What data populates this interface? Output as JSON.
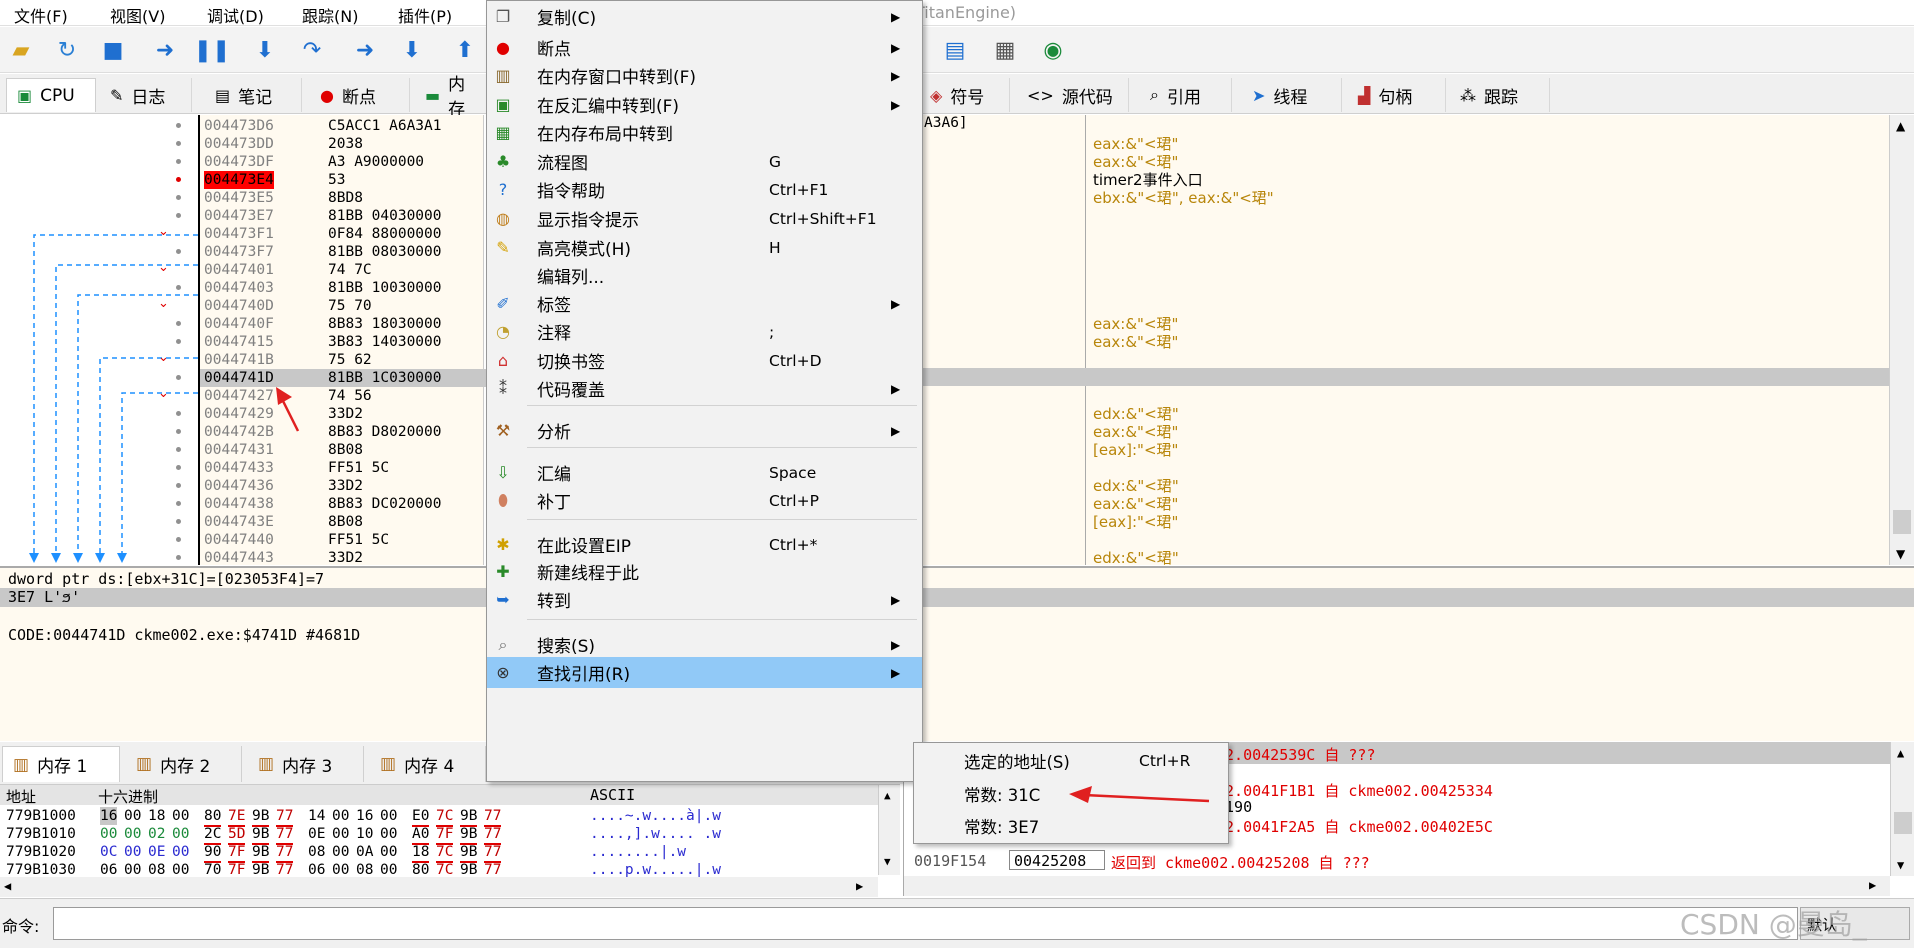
{
  "menubar": {
    "items": [
      "文件(F)",
      "视图(V)",
      "调试(D)",
      "跟踪(N)",
      "插件(P)"
    ],
    "title_fragment": "TitanEngine)"
  },
  "tabs": [
    "CPU",
    "日志",
    "笔记",
    "断点",
    "内存"
  ],
  "tabs_right": [
    "符号",
    "源代码",
    "引用",
    "线程",
    "句柄",
    "跟踪"
  ],
  "disasm": {
    "rows": [
      {
        "addr": "004473D6",
        "bytes": "C5ACC1 A6A3A1",
        "mark": ""
      },
      {
        "addr": "004473DD",
        "bytes": "2038",
        "mark": ""
      },
      {
        "addr": "004473DF",
        "bytes": "A3 A9000000",
        "mark": ""
      },
      {
        "addr": "004473E4",
        "bytes": "53",
        "mark": "bp"
      },
      {
        "addr": "004473E5",
        "bytes": "8BD8",
        "mark": ""
      },
      {
        "addr": "004473E7",
        "bytes": "81BB 04030000",
        "mark": ""
      },
      {
        "addr": "004473F1",
        "bytes": "0F84 88000000",
        "mark": "jmp"
      },
      {
        "addr": "004473F7",
        "bytes": "81BB 08030000",
        "mark": ""
      },
      {
        "addr": "00447401",
        "bytes": "74 7C",
        "mark": "jmp"
      },
      {
        "addr": "00447403",
        "bytes": "81BB 10030000",
        "mark": ""
      },
      {
        "addr": "0044740D",
        "bytes": "75 70",
        "mark": "jmp"
      },
      {
        "addr": "0044740F",
        "bytes": "8B83 18030000",
        "mark": ""
      },
      {
        "addr": "00447415",
        "bytes": "3B83 14030000",
        "mark": ""
      },
      {
        "addr": "0044741B",
        "bytes": "75 62",
        "mark": "jmp"
      },
      {
        "addr": "0044741D",
        "bytes": "81BB 1C030000",
        "mark": "sel"
      },
      {
        "addr": "00447427",
        "bytes": "74 56",
        "mark": "jmp"
      },
      {
        "addr": "00447429",
        "bytes": "33D2",
        "mark": ""
      },
      {
        "addr": "0044742B",
        "bytes": "8B83 D8020000",
        "mark": ""
      },
      {
        "addr": "00447431",
        "bytes": "8B08",
        "mark": ""
      },
      {
        "addr": "00447433",
        "bytes": "FF51 5C",
        "mark": ""
      },
      {
        "addr": "00447436",
        "bytes": "33D2",
        "mark": ""
      },
      {
        "addr": "00447438",
        "bytes": "8B83 DC020000",
        "mark": ""
      },
      {
        "addr": "0044743E",
        "bytes": "8B08",
        "mark": ""
      },
      {
        "addr": "00447440",
        "bytes": "FF51 5C",
        "mark": ""
      },
      {
        "addr": "00447443",
        "bytes": "33D2",
        "mark": ""
      }
    ],
    "right_fragment": "A3A6]",
    "comments": [
      {
        "row": 1,
        "text": "eax:&\"<珺\""
      },
      {
        "row": 2,
        "text": "eax:&\"<珺\""
      },
      {
        "row": 3,
        "text": "timer2事件入口",
        "black": true
      },
      {
        "row": 4,
        "text": "ebx:&\"<珺\", eax:&\"<珺\""
      },
      {
        "row": 11,
        "text": "eax:&\"<珺\""
      },
      {
        "row": 12,
        "text": "eax:&\"<珺\""
      },
      {
        "row": 16,
        "text": "edx:&\"<珺\""
      },
      {
        "row": 17,
        "text": "eax:&\"<珺\""
      },
      {
        "row": 18,
        "text": "[eax]:\"<珺\""
      },
      {
        "row": 20,
        "text": "edx:&\"<珺\""
      },
      {
        "row": 21,
        "text": "eax:&\"<珺\""
      },
      {
        "row": 22,
        "text": "[eax]:\"<珺\""
      },
      {
        "row": 24,
        "text": "edx:&\"<珺\""
      }
    ]
  },
  "info": {
    "line1": "dword ptr ds:[ebx+31C]=[023053F4]=7",
    "line2": "3E7 L'ϧ'",
    "line3": "CODE:0044741D ckme002.exe:$4741D #4681D"
  },
  "context_menu": {
    "items": [
      {
        "icon": "copy-icon",
        "label": "复制(C)",
        "shortcut": "",
        "arrow": true
      },
      {
        "icon": "breakpoint-icon",
        "label": "断点",
        "shortcut": "",
        "arrow": true
      },
      {
        "icon": "memory-icon",
        "label": "在内存窗口中转到(F)",
        "shortcut": "",
        "arrow": true
      },
      {
        "icon": "disasm-icon",
        "label": "在反汇编中转到(F)",
        "shortcut": "",
        "arrow": true
      },
      {
        "icon": "memmap-icon",
        "label": "在内存布局中转到",
        "shortcut": "",
        "arrow": false
      },
      {
        "icon": "graph-icon",
        "label": "流程图",
        "shortcut": "G",
        "arrow": false
      },
      {
        "icon": "help-icon",
        "label": "指令帮助",
        "shortcut": "Ctrl+F1",
        "arrow": false
      },
      {
        "icon": "hint-icon",
        "label": "显示指令提示",
        "shortcut": "Ctrl+Shift+F1",
        "arrow": false
      },
      {
        "icon": "highlight-icon",
        "label": "高亮模式(H)",
        "shortcut": "H",
        "arrow": false
      },
      {
        "icon": "",
        "label": "编辑列...",
        "shortcut": "",
        "arrow": false
      },
      {
        "icon": "label-icon",
        "label": "标签",
        "shortcut": "",
        "arrow": true
      },
      {
        "icon": "comment-icon",
        "label": "注释",
        "shortcut": ";",
        "arrow": false
      },
      {
        "icon": "bookmark-icon",
        "label": "切换书签",
        "shortcut": "Ctrl+D",
        "arrow": false
      },
      {
        "icon": "coverage-icon",
        "label": "代码覆盖",
        "shortcut": "",
        "arrow": true
      },
      {
        "icon": "analyze-icon",
        "label": "分析",
        "shortcut": "",
        "arrow": true
      },
      {
        "icon": "assemble-icon",
        "label": "汇编",
        "shortcut": "Space",
        "arrow": false
      },
      {
        "icon": "patch-icon",
        "label": "补丁",
        "shortcut": "Ctrl+P",
        "arrow": false
      },
      {
        "icon": "eip-icon",
        "label": "在此设置EIP",
        "shortcut": "Ctrl+*",
        "arrow": false
      },
      {
        "icon": "thread-icon",
        "label": "新建线程于此",
        "shortcut": "",
        "arrow": false
      },
      {
        "icon": "goto-icon",
        "label": "转到",
        "shortcut": "",
        "arrow": true
      },
      {
        "icon": "search-icon",
        "label": "搜索(S)",
        "shortcut": "",
        "arrow": true
      },
      {
        "icon": "binoculars-icon",
        "label": "查找引用(R)",
        "shortcut": "",
        "arrow": true
      }
    ]
  },
  "submenu": {
    "items": [
      {
        "label": "选定的地址(S)",
        "shortcut": "Ctrl+R"
      },
      {
        "label": "常数: 31C",
        "shortcut": ""
      },
      {
        "label": "常数: 3E7",
        "shortcut": ""
      }
    ]
  },
  "memtabs": [
    "内存 1",
    "内存 2",
    "内存 3",
    "内存 4"
  ],
  "dump": {
    "headers": [
      "地址",
      "十六进制",
      "ASCII"
    ],
    "rows": [
      {
        "addr": "779B1000",
        "hex": [
          "16",
          "00",
          "18",
          "00",
          "80",
          "7E",
          "9B",
          "77",
          "14",
          "00",
          "16",
          "00",
          "E0",
          "7C",
          "9B",
          "77"
        ],
        "ascii": "....~.w....à|.w"
      },
      {
        "addr": "779B1010",
        "hex": [
          "00",
          "00",
          "02",
          "00",
          "2C",
          "5D",
          "9B",
          "77",
          "0E",
          "00",
          "10",
          "00",
          "A0",
          "7F",
          "9B",
          "77"
        ],
        "ascii": "....,].w.... .w"
      },
      {
        "addr": "779B1020",
        "hex": [
          "0C",
          "00",
          "0E",
          "00",
          "90",
          "7F",
          "9B",
          "77",
          "08",
          "00",
          "0A",
          "00",
          "18",
          "7C",
          "9B",
          "77"
        ],
        "ascii": "........|.w"
      },
      {
        "addr": "779B1030",
        "hex": [
          "06",
          "00",
          "08",
          "00",
          "70",
          "7F",
          "9B",
          "77",
          "06",
          "00",
          "08",
          "00",
          "80",
          "7C",
          "9B",
          "77"
        ],
        "ascii": "....p.w.....|.w"
      }
    ]
  },
  "stack": {
    "rows": [
      {
        "text": "02.0042539C 自 ???"
      },
      {
        "text": "02.0041F1B1 自 ckme002.00425334"
      },
      {
        "text": "F190"
      },
      {
        "text": "02.0041F2A5 自 ckme002.00402E5C"
      },
      {
        "addr": "0019F154",
        "val": "00425208",
        "text": "返回到 ckme002.00425208 自 ???"
      }
    ]
  },
  "command": {
    "label": "命令:",
    "default": "默认"
  },
  "watermark": "CSDN @曼岛_"
}
